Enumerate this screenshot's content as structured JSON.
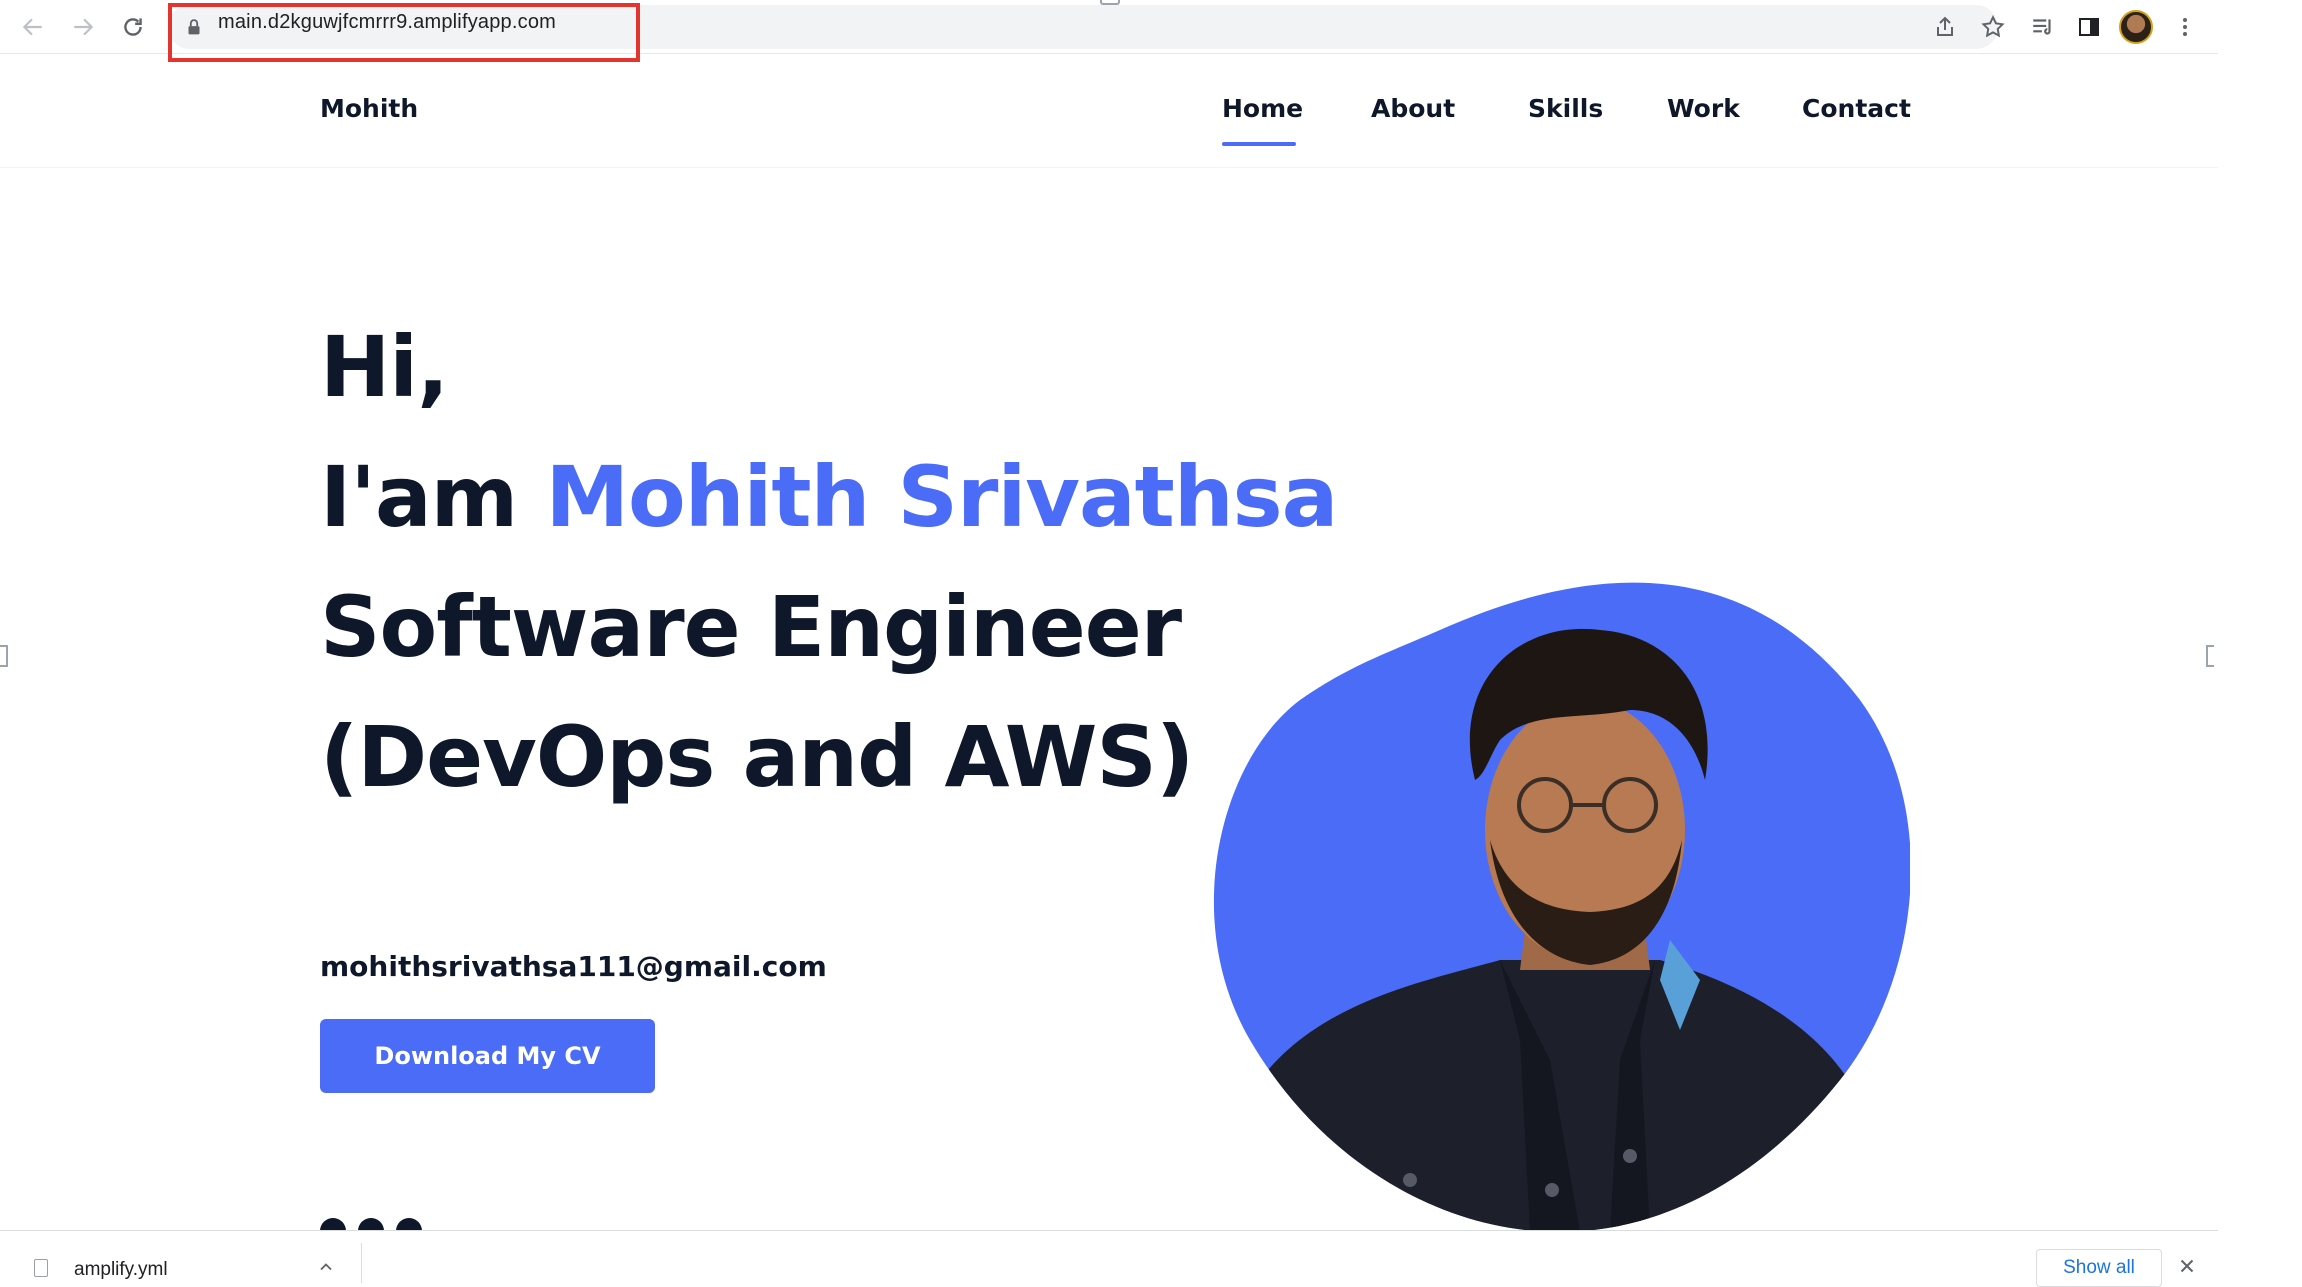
{
  "browser": {
    "url": "main.d2kguwjfcmrrr9.amplifyapp.com"
  },
  "site": {
    "brand": "Mohith",
    "nav": [
      {
        "label": "Home",
        "active": true
      },
      {
        "label": "About",
        "active": false
      },
      {
        "label": "Skills",
        "active": false
      },
      {
        "label": "Work",
        "active": false
      },
      {
        "label": "Contact",
        "active": false
      }
    ]
  },
  "hero": {
    "greeting": "Hi,",
    "intro_prefix": "I'am ",
    "name": "Mohith Srivathsa",
    "role_line1": "Software Engineer",
    "role_line2": "(DevOps and AWS)",
    "email": "mohithsrivathsa111@gmail.com",
    "cv_button": "Download My CV"
  },
  "downloads": {
    "filename": "amplify.yml",
    "show_all": "Show all"
  },
  "icons": {
    "back": "back-arrow-icon",
    "forward": "forward-arrow-icon",
    "reload": "reload-icon",
    "lock": "lock-icon",
    "share": "share-icon",
    "bookmark": "star-icon",
    "reading_list": "reading-list-icon",
    "side_panel": "side-panel-icon",
    "menu": "kebab-menu-icon"
  },
  "colors": {
    "accent": "#4a6cf7",
    "text_dark": "#0f172a",
    "highlight_box": "#e3342f",
    "link_blue": "#1a73e8"
  }
}
